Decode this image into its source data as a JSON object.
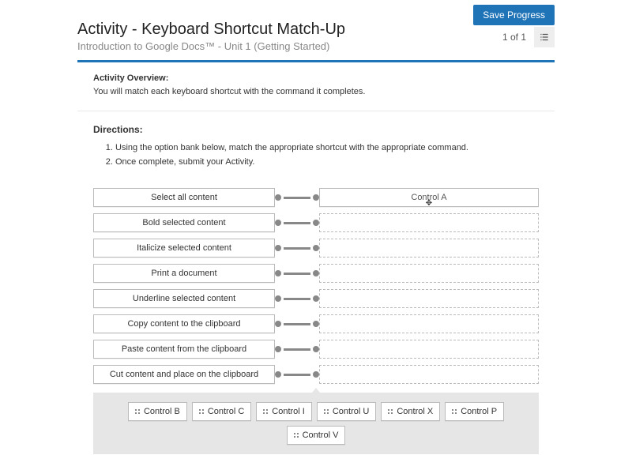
{
  "header": {
    "save_label": "Save Progress",
    "title": "Activity - Keyboard Shortcut Match-Up",
    "subtitle": "Introduction to Google Docs™ - Unit 1 (Getting Started)",
    "pager": "1 of 1"
  },
  "overview": {
    "heading": "Activity Overview:",
    "text": "You will match each keyboard shortcut with the command it completes."
  },
  "directions": {
    "heading": "Directions:",
    "items": [
      "Using the option bank below, match the appropriate shortcut with the appropriate command.",
      "Once complete, submit your Activity."
    ]
  },
  "rows": [
    {
      "command": "Select all content",
      "answer": "Control A"
    },
    {
      "command": "Bold selected content",
      "answer": ""
    },
    {
      "command": "Italicize selected content",
      "answer": ""
    },
    {
      "command": "Print a document",
      "answer": ""
    },
    {
      "command": "Underline selected content",
      "answer": ""
    },
    {
      "command": "Copy content to the clipboard",
      "answer": ""
    },
    {
      "command": "Paste content from the clipboard",
      "answer": ""
    },
    {
      "command": "Cut content and place on the clipboard",
      "answer": ""
    }
  ],
  "bank": [
    "Control B",
    "Control C",
    "Control I",
    "Control U",
    "Control X",
    "Control P",
    "Control V"
  ]
}
